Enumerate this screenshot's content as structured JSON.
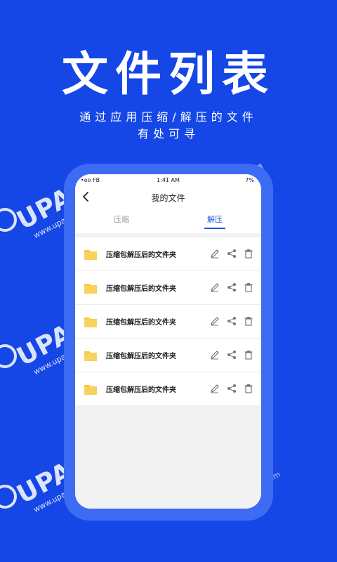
{
  "hero": {
    "title": "文件列表",
    "subtitle_line1": "通过应用压缩/解压的文件",
    "subtitle_line2": "有处可寻"
  },
  "watermark": {
    "brand": "UPAN",
    "url": "www.upanbook.com"
  },
  "status_bar": {
    "left": "•oo FB",
    "time": "1:41 AM",
    "right": "7%"
  },
  "nav": {
    "title": "我的文件",
    "back_icon": "chevron-left-icon"
  },
  "tabs": {
    "compress": "压缩",
    "extract": "解压",
    "active": "extract"
  },
  "files": [
    {
      "name": "压缩包解压后的文件夹"
    },
    {
      "name": "压缩包解压后的文件夹"
    },
    {
      "name": "压缩包解压后的文件夹"
    },
    {
      "name": "压缩包解压后的文件夹"
    },
    {
      "name": "压缩包解压后的文件夹"
    }
  ],
  "icons": {
    "folder": "folder-icon",
    "edit": "pencil-icon",
    "share": "share-icon",
    "delete": "trash-icon"
  },
  "colors": {
    "background": "#1547e6",
    "phone_frame": "#3d6bf3",
    "accent": "#1f5bd6",
    "folder": "#f7c843"
  }
}
